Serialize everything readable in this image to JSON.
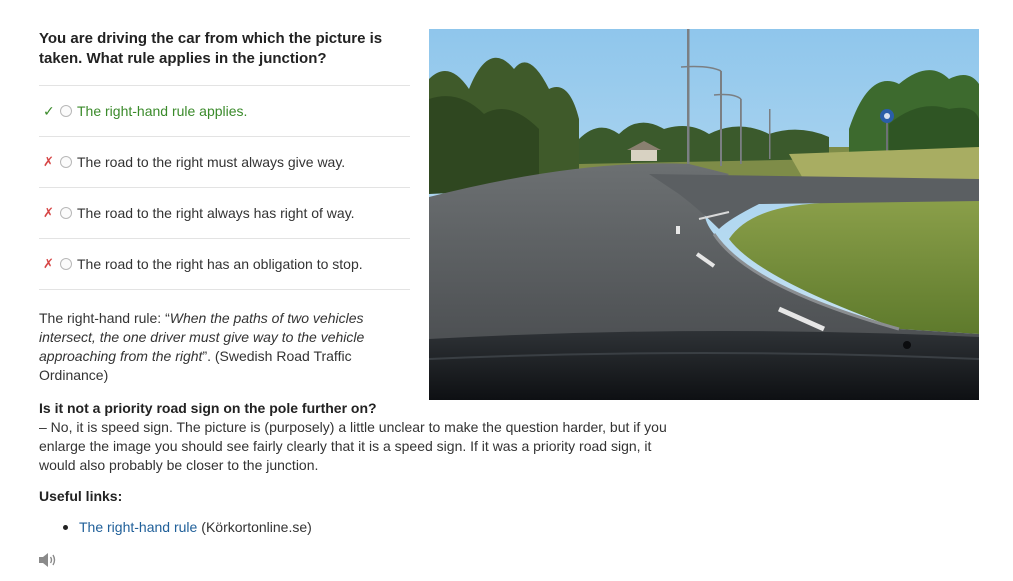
{
  "question": {
    "text": "You are driving the car from which the picture is taken. What rule applies in the junction?"
  },
  "options": [
    {
      "mark": "✓",
      "status": "correct",
      "label": "The right-hand rule applies."
    },
    {
      "mark": "✗",
      "status": "wrong",
      "label": "The road to the right must always give way."
    },
    {
      "mark": "✗",
      "status": "wrong",
      "label": "The road to the right always has right of way."
    },
    {
      "mark": "✗",
      "status": "wrong",
      "label": "The road to the right has an obligation to stop."
    }
  ],
  "explanation": {
    "prefix": "The right-hand rule: “",
    "quote": "When the paths of two vehicles intersect, the one driver must give way to the vehicle approaching from the right",
    "suffix": "”. (Swedish Road Traffic Ordinance)"
  },
  "faq": {
    "question": "Is it not a priority road sign on the pole further on?",
    "answer": "– No, it is speed sign. The picture is (purposely) a little unclear to make the question harder, but if you enlarge the image you should see fairly clearly that it is a speed sign. If it was a priority road sign, it would also probably be closer to the junction."
  },
  "useful_links": {
    "title": "Useful links:",
    "items": [
      {
        "label": "The right-hand rule",
        "source": "(Körkortonline.se)"
      }
    ]
  },
  "icons": {
    "audio": "speaker-icon",
    "correct": "checkmark-icon",
    "wrong": "cross-icon"
  },
  "colors": {
    "correct": "#3a8a2a",
    "wrong": "#d64545",
    "link": "#1f5f99"
  }
}
